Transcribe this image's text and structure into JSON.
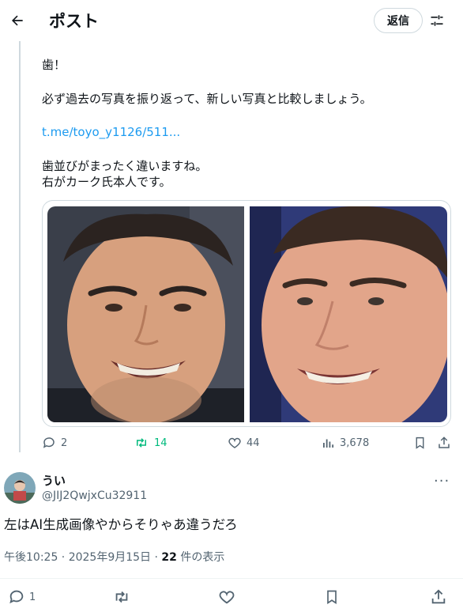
{
  "header": {
    "title": "ポスト",
    "reply_label": "返信"
  },
  "tweet": {
    "lines": {
      "l1": "歯！",
      "l2": "必ず過去の写真を振り返って、新しい写真と比較しましょう。",
      "link": "t.me/toyo_y1126/511...",
      "l4": "歯並びがまったく違いますね。",
      "l5": "右がカーク氏本人です。"
    },
    "stats": {
      "replies": "2",
      "retweets": "14",
      "likes": "44",
      "views": "3,678"
    }
  },
  "reply": {
    "name": "うい",
    "handle": "@JIJ2QwjxCu32911",
    "text": "左はAI生成画像やからそりゃあ違うだろ",
    "time": "午後10:25 · 2025年9月15日 · ",
    "views_count": "22",
    "views_suffix": " 件の表示",
    "reply_count": "1"
  },
  "colors": {
    "accent": "#1d9bf0",
    "retweet_green": "#00ba7c",
    "secondary": "#536471"
  },
  "icons": [
    "back-arrow-icon",
    "filter-sliders-icon",
    "comment-icon",
    "retweet-icon",
    "heart-icon",
    "views-chart-icon",
    "bookmark-icon",
    "share-icon",
    "more-icon"
  ]
}
